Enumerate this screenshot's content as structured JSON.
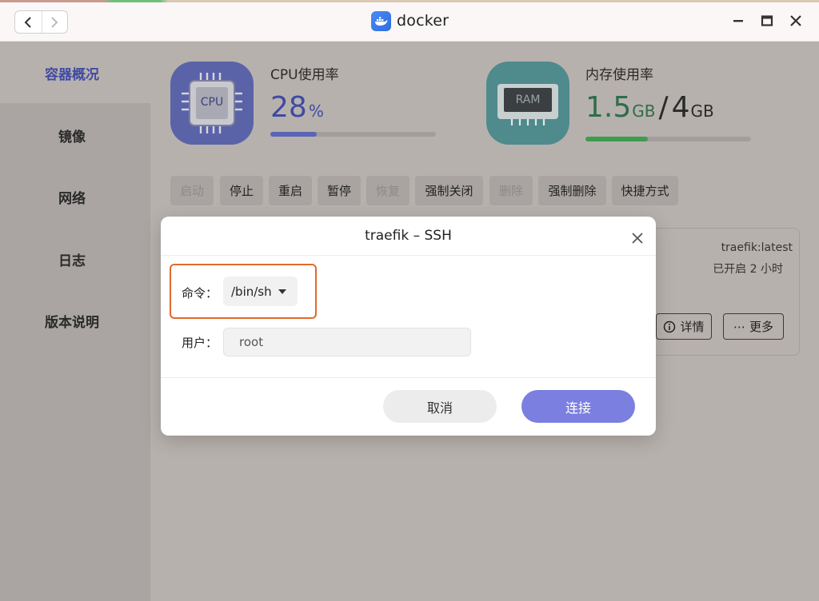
{
  "window": {
    "title": "docker"
  },
  "sidebar": {
    "items": [
      {
        "label": "容器概况",
        "active": true
      },
      {
        "label": "镜像"
      },
      {
        "label": "网络"
      },
      {
        "label": "日志"
      },
      {
        "label": "版本说明"
      }
    ]
  },
  "stats": {
    "cpu": {
      "label": "CPU使用率",
      "icon_text": "CPU",
      "value": "28",
      "unit": "%",
      "fraction": 0.28
    },
    "memory": {
      "label": "内存使用率",
      "icon_text": "RAM",
      "used": "1.5",
      "used_unit": "GB",
      "separator": "/",
      "total": "4",
      "total_unit": "GB",
      "fraction": 0.375
    }
  },
  "toolbar": {
    "buttons": [
      {
        "label": "启动",
        "disabled": true
      },
      {
        "label": "停止"
      },
      {
        "label": "重启"
      },
      {
        "label": "暂停"
      },
      {
        "label": "恢复",
        "disabled": true
      },
      {
        "label": "强制关闭"
      },
      {
        "label": "删除",
        "disabled": true
      },
      {
        "label": "强制删除"
      },
      {
        "label": "快捷方式"
      }
    ]
  },
  "container_card": {
    "image": "traefik:latest",
    "status": "已开启 2 小时",
    "details_label": "详情",
    "more_label": "更多"
  },
  "dialog": {
    "title": "traefik – SSH",
    "command_label": "命令：",
    "command_value": "/bin/sh",
    "user_label": "用户：",
    "user_value": "root",
    "cancel_label": "取消",
    "connect_label": "连接"
  },
  "colors": {
    "accent": "#7b7fe0",
    "cpu_bar": "#5b65b5",
    "mem_bar": "#3f9b4f",
    "highlight": "#e06a2c",
    "sidebar_active": "#3f4aa3"
  }
}
